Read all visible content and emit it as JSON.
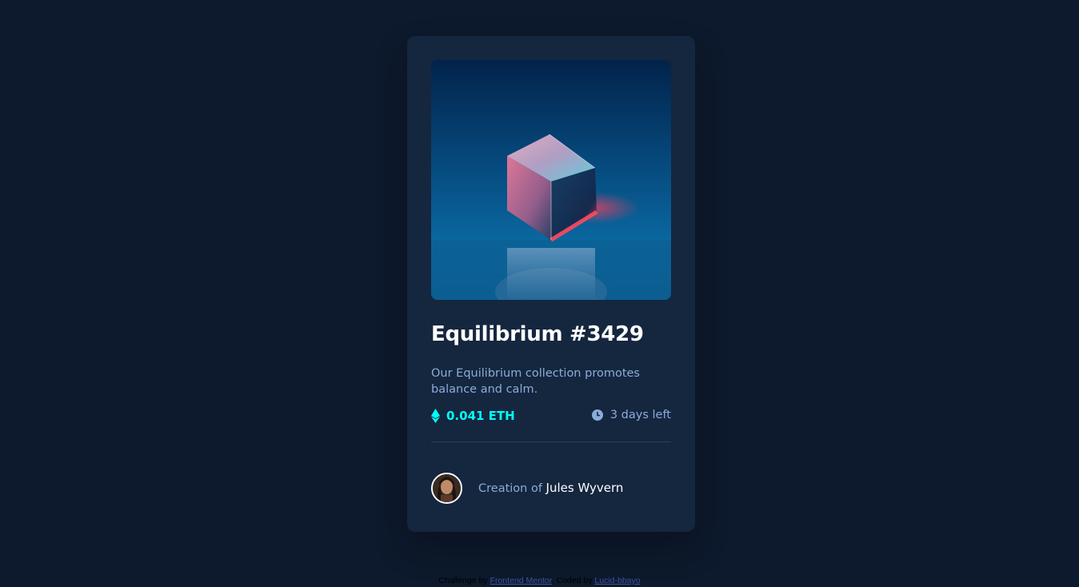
{
  "card": {
    "title": "Equilibrium #3429",
    "description": "Our Equilibrium collection promotes balance and calm.",
    "price": "0.041 ETH",
    "time_left": "3 days left",
    "creator_prefix": "Creation of",
    "creator_name": "Jules Wyvern",
    "hero_image": "equilibrium-cube-image",
    "avatar_image": "jules-wyvern-avatar",
    "icons": {
      "price": "ethereum-icon",
      "time": "clock-icon"
    }
  },
  "attribution": {
    "challenge_prefix": "Challenge by",
    "challenge_link": "Frontend Mentor",
    "separator": ". Coded by",
    "author_link": "Lucid-bbayo"
  },
  "colors": {
    "page_background": "#0d192c",
    "card_background": "#15263f",
    "accent_cyan": "#00fff8",
    "soft_blue": "#8bacd9",
    "white": "#ffffff",
    "divider": "#2e405a"
  }
}
